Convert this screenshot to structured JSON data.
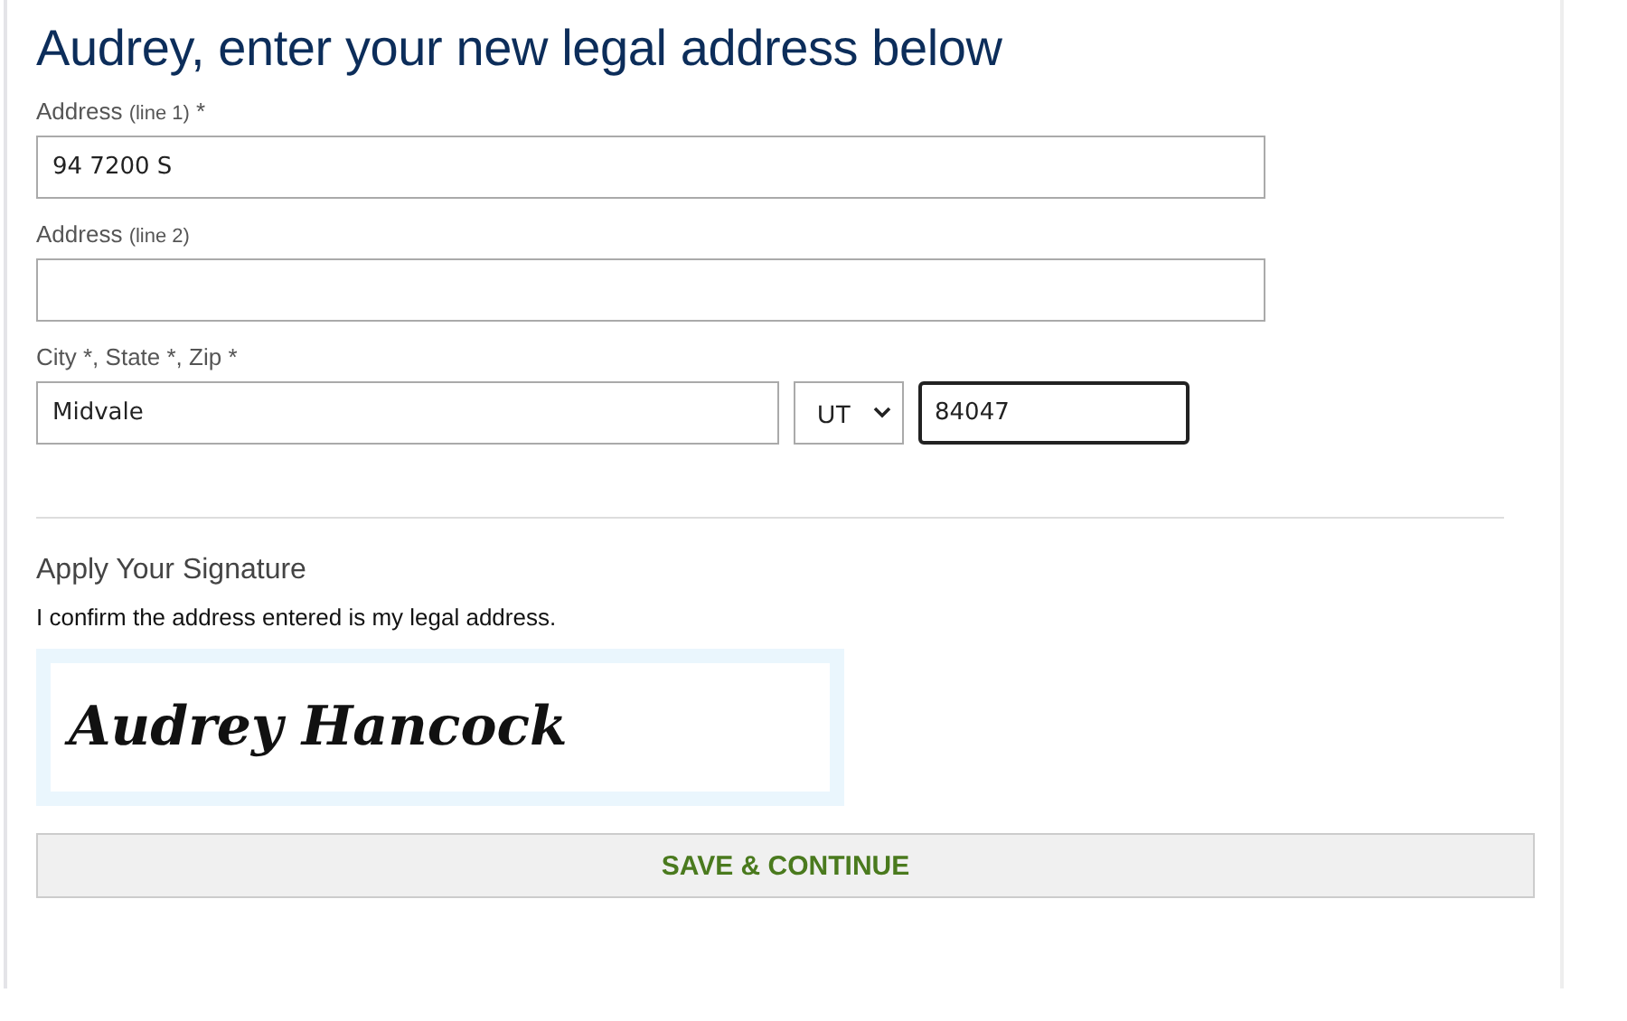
{
  "heading": "Audrey, enter your new legal address below",
  "fields": [
    {
      "label": "Address",
      "hint": "(line 1)",
      "required_mark": "*",
      "value": "94 7200 S"
    },
    {
      "label": "Address",
      "hint": "(line 2)"
    }
  ],
  "city_row": {
    "label": "City *, State *, Zip *",
    "city": {
      "value": "Midvale",
      "focused": false
    },
    "state": {
      "value": "UT"
    },
    "zip": {
      "value": "84047",
      "focused": true
    }
  },
  "signature": {
    "title": "Apply Your Signature",
    "statement": "I confirm the address entered is my legal address.",
    "name": "Audrey Hancock"
  },
  "button": "SAVE & CONTINUE"
}
